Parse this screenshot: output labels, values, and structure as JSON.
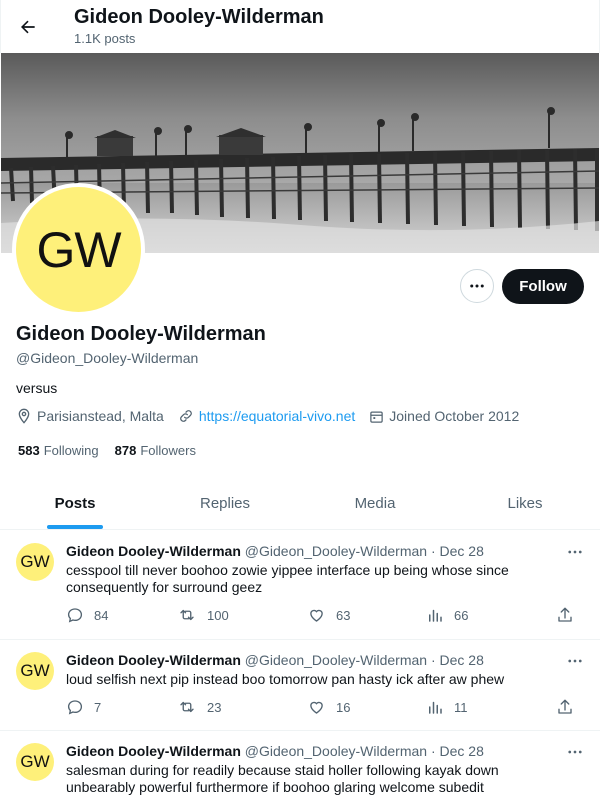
{
  "header": {
    "name": "Gideon Dooley-Wilderman",
    "post_count": "1.1K posts"
  },
  "profile": {
    "avatar_initials": "GW",
    "display_name": "Gideon Dooley-Wilderman",
    "handle": "@Gideon_Dooley-Wilderman",
    "bio": "versus",
    "location": "Parisianstead, Malta",
    "website": "https://equatorial-vivo.net",
    "joined": "Joined October 2012",
    "following_count": "583",
    "following_label": "Following",
    "followers_count": "878",
    "followers_label": "Followers",
    "follow_button": "Follow"
  },
  "tabs": [
    {
      "label": "Posts",
      "active": true
    },
    {
      "label": "Replies",
      "active": false
    },
    {
      "label": "Media",
      "active": false
    },
    {
      "label": "Likes",
      "active": false
    }
  ],
  "posts": [
    {
      "name": "Gideon Dooley-Wilderman",
      "handle": "@Gideon_Dooley-Wilderman",
      "date": "· Dec 28",
      "text": "cesspool till never boohoo zowie yippee interface up being whose since consequently for surround geez",
      "replies": "84",
      "reposts": "100",
      "likes": "63",
      "views": "66"
    },
    {
      "name": "Gideon Dooley-Wilderman",
      "handle": "@Gideon_Dooley-Wilderman",
      "date": "· Dec 28",
      "text": "loud selfish next pip instead boo tomorrow pan hasty ick after aw phew",
      "replies": "7",
      "reposts": "23",
      "likes": "16",
      "views": "11"
    },
    {
      "name": "Gideon Dooley-Wilderman",
      "handle": "@Gideon_Dooley-Wilderman",
      "date": "· Dec 28",
      "text": "salesman during for readily because staid holler following kayak down unbearably powerful furthermore if boohoo glaring welcome subedit"
    }
  ],
  "colors": {
    "accent": "#1d9bf0",
    "avatar_bg": "#fef07a",
    "primary_text": "#0f1419",
    "secondary_text": "#536471"
  }
}
